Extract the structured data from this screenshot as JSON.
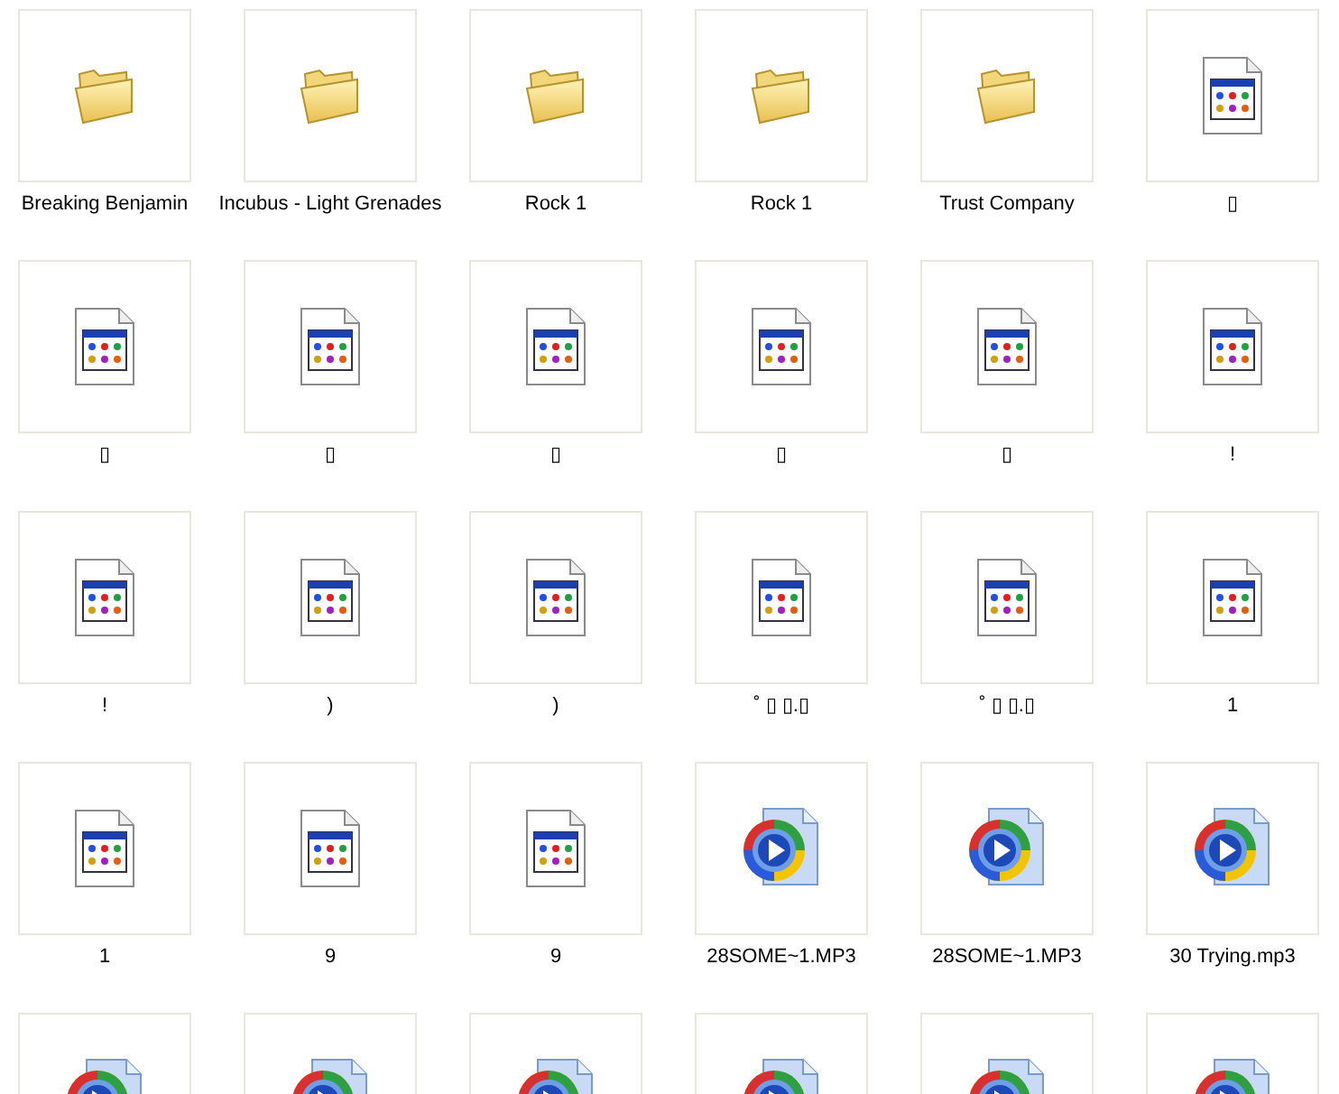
{
  "items": [
    {
      "kind": "folder",
      "label": "Breaking Benjamin"
    },
    {
      "kind": "folder",
      "label": "Incubus - Light Grenades"
    },
    {
      "kind": "folder",
      "label": "Rock 1"
    },
    {
      "kind": "folder",
      "label": "Rock 1"
    },
    {
      "kind": "folder",
      "label": "Trust Company"
    },
    {
      "kind": "program",
      "label": "▯"
    },
    {
      "kind": "program",
      "label": "▯"
    },
    {
      "kind": "program",
      "label": "▯"
    },
    {
      "kind": "program",
      "label": "▯"
    },
    {
      "kind": "program",
      "label": "▯"
    },
    {
      "kind": "program",
      "label": "▯"
    },
    {
      "kind": "program",
      "label": "!"
    },
    {
      "kind": "program",
      "label": "!"
    },
    {
      "kind": "program",
      "label": ")"
    },
    {
      "kind": "program",
      "label": ")"
    },
    {
      "kind": "program",
      "label": "˚ ▯ ▯.▯"
    },
    {
      "kind": "program",
      "label": "˚ ▯ ▯.▯"
    },
    {
      "kind": "program",
      "label": "1"
    },
    {
      "kind": "program",
      "label": "1"
    },
    {
      "kind": "program",
      "label": "9"
    },
    {
      "kind": "program",
      "label": "9"
    },
    {
      "kind": "media",
      "label": "28SOME~1.MP3"
    },
    {
      "kind": "media",
      "label": "28SOME~1.MP3"
    },
    {
      "kind": "media",
      "label": "30 Trying.mp3"
    },
    {
      "kind": "media"
    },
    {
      "kind": "media"
    },
    {
      "kind": "media"
    },
    {
      "kind": "media"
    },
    {
      "kind": "media"
    },
    {
      "kind": "media"
    }
  ]
}
